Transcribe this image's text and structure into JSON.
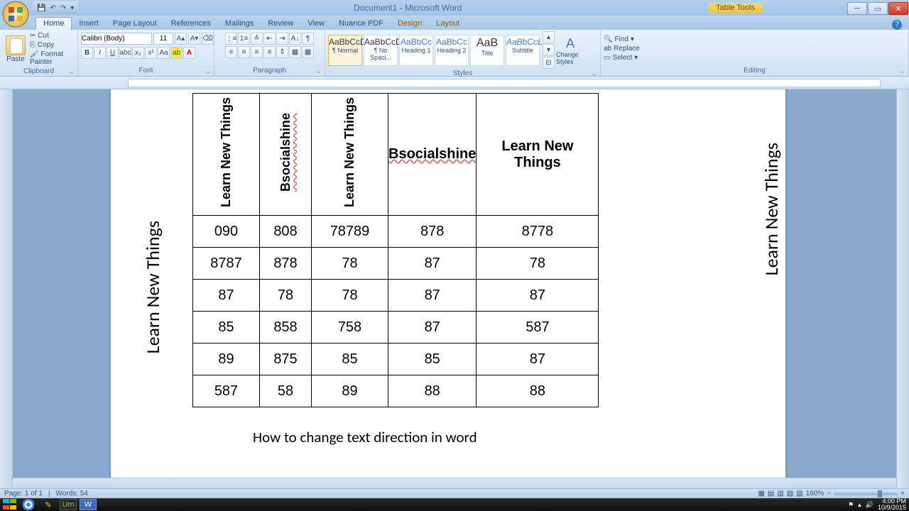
{
  "window": {
    "title": "Document1 - Microsoft Word",
    "context_tab_group": "Table Tools"
  },
  "tabs": {
    "home": "Home",
    "insert": "Insert",
    "page_layout": "Page Layout",
    "references": "References",
    "mailings": "Mailings",
    "review": "Review",
    "view": "View",
    "nuance": "Nuance PDF",
    "design": "Design",
    "layout": "Layout"
  },
  "ribbon": {
    "clipboard": {
      "label": "Clipboard",
      "paste": "Paste",
      "cut": "Cut",
      "copy": "Copy",
      "format_painter": "Format Painter"
    },
    "font": {
      "label": "Font",
      "name": "Calibri (Body)",
      "size": "11"
    },
    "paragraph": {
      "label": "Paragraph"
    },
    "styles": {
      "label": "Styles",
      "items": [
        {
          "preview": "AaBbCcDd",
          "name": "¶ Normal"
        },
        {
          "preview": "AaBbCcDd",
          "name": "¶ No Spaci..."
        },
        {
          "preview": "AaBbCc",
          "name": "Heading 1"
        },
        {
          "preview": "AaBbCc",
          "name": "Heading 2"
        },
        {
          "preview": "AaB",
          "name": "Title"
        },
        {
          "preview": "AaBbCcL",
          "name": "Subtitle"
        }
      ],
      "change": "Change Styles"
    },
    "editing": {
      "label": "Editing",
      "find": "Find",
      "replace": "Replace",
      "select": "Select"
    }
  },
  "document": {
    "side_text": "Learn New Things",
    "headers": [
      "Learn New Things",
      "Bsocialshine",
      "Learn New Things",
      "Bsocialshine",
      "Learn New Things"
    ],
    "rows": [
      [
        "090",
        "808",
        "78789",
        "878",
        "8778"
      ],
      [
        "8787",
        "878",
        "78",
        "87",
        "78"
      ],
      [
        "87",
        "78",
        "78",
        "87",
        "87"
      ],
      [
        "85",
        "858",
        "758",
        "87",
        "587"
      ],
      [
        "89",
        "875",
        "85",
        "85",
        "87"
      ],
      [
        "587",
        "58",
        "89",
        "88",
        "88"
      ]
    ],
    "caption": "How to change text direction in word"
  },
  "status": {
    "page": "Page: 1 of 1",
    "words": "Words: 54",
    "zoom": "160%"
  },
  "tray": {
    "time": "4:00 PM",
    "date": "10/9/2015"
  }
}
